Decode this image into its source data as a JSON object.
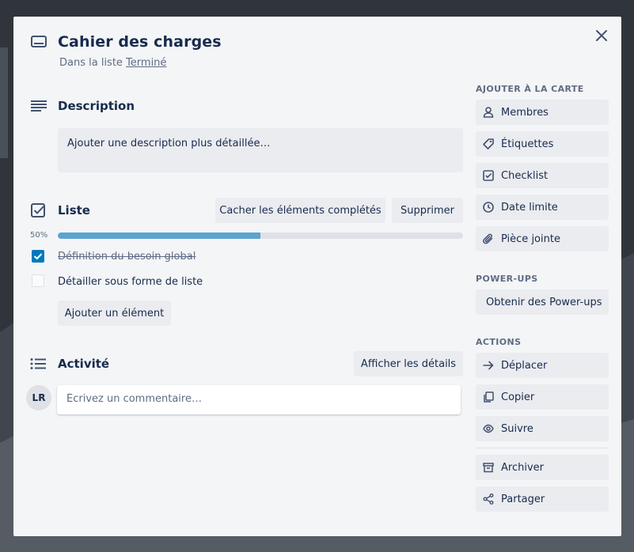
{
  "card": {
    "title": "Cahier des charges",
    "list_prefix": "Dans la liste ",
    "list_name": "Terminé"
  },
  "description": {
    "heading": "Description",
    "placeholder": "Ajouter une description plus détaillée…"
  },
  "checklist": {
    "heading": "Liste",
    "hide_completed_label": "Cacher les éléments complétés",
    "delete_label": "Supprimer",
    "progress_label": "50%",
    "progress_fraction": 0.5,
    "items": [
      {
        "text": "Définition du besoin global",
        "checked": true
      },
      {
        "text": "Détailler sous forme de liste",
        "checked": false
      }
    ],
    "add_item_label": "Ajouter un élément"
  },
  "activity": {
    "heading": "Activité",
    "show_details_label": "Afficher les détails",
    "avatar_initials": "LR",
    "comment_placeholder": "Écrivez un commentaire…"
  },
  "sidebar": {
    "add_to_card_heading": "AJOUTER À LA CARTE",
    "add_to_card": [
      {
        "label": "Membres",
        "icon": "person-icon"
      },
      {
        "label": "Étiquettes",
        "icon": "tag-icon"
      },
      {
        "label": "Checklist",
        "icon": "checklist-icon"
      },
      {
        "label": "Date limite",
        "icon": "clock-icon"
      },
      {
        "label": "Pièce jointe",
        "icon": "paperclip-icon"
      }
    ],
    "powerups_heading": "POWER-UPS",
    "powerups_button": "Obtenir des Power-ups",
    "actions_heading": "ACTIONS",
    "actions": [
      {
        "label": "Déplacer",
        "icon": "arrow-right-icon"
      },
      {
        "label": "Copier",
        "icon": "copy-icon"
      },
      {
        "label": "Suivre",
        "icon": "eye-icon"
      }
    ],
    "secondary_actions": [
      {
        "label": "Archiver",
        "icon": "archive-icon"
      },
      {
        "label": "Partager",
        "icon": "share-icon"
      }
    ]
  },
  "colors": {
    "accent": "#0079bf",
    "progress": "#5ba4cf",
    "modal_bg": "#f4f5f7",
    "button_bg": "#ebecf0",
    "text": "#172b4d",
    "muted": "#5e6c84"
  }
}
